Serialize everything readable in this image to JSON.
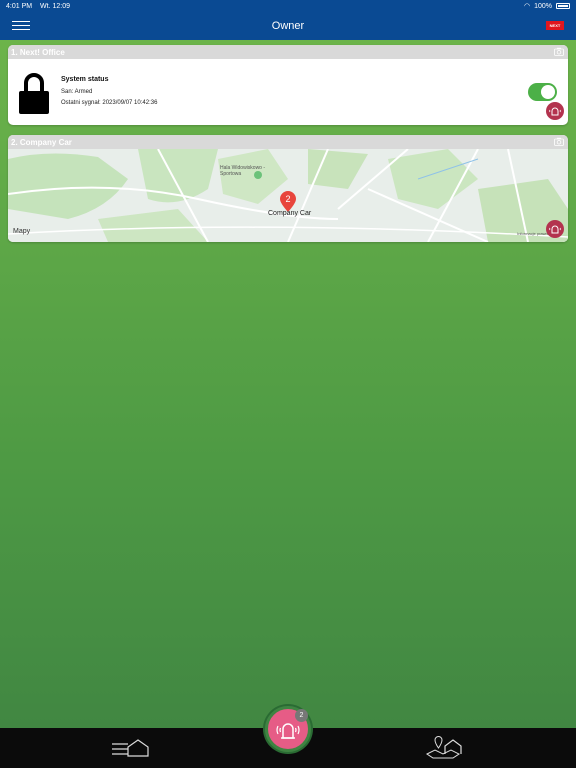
{
  "status_bar": {
    "time": "4:01 PM",
    "date": "Wt. 12:09",
    "battery": "100%"
  },
  "header": {
    "title": "Owner",
    "logo_text": "NEXT"
  },
  "cards": [
    {
      "title": "1. Next! Office",
      "system_title": "System status",
      "state": "San: Armed",
      "last_signal": "Ostatni sygnał: 2023/09/07 10:42:36",
      "armed": true
    },
    {
      "title": "2. Company Car",
      "map": {
        "pin_count": "2",
        "pin_label": "Company Car",
        "place_label": "Hala Widowiskowo - Sportowa",
        "attribution": "Mapy",
        "legal": "Informacje prawne"
      }
    }
  ],
  "alarm": {
    "badge": "2"
  },
  "colors": {
    "nav": "#0a4a93",
    "toggle_on": "#4cb047",
    "siren": "#b3334e",
    "alarm": "#e65c86"
  },
  "icons": {
    "menu": "menu-icon",
    "lock": "lock-icon",
    "camera": "camera-icon",
    "siren": "siren-icon",
    "tab_left": "list-house-icon",
    "tab_right": "map-house-icon"
  }
}
